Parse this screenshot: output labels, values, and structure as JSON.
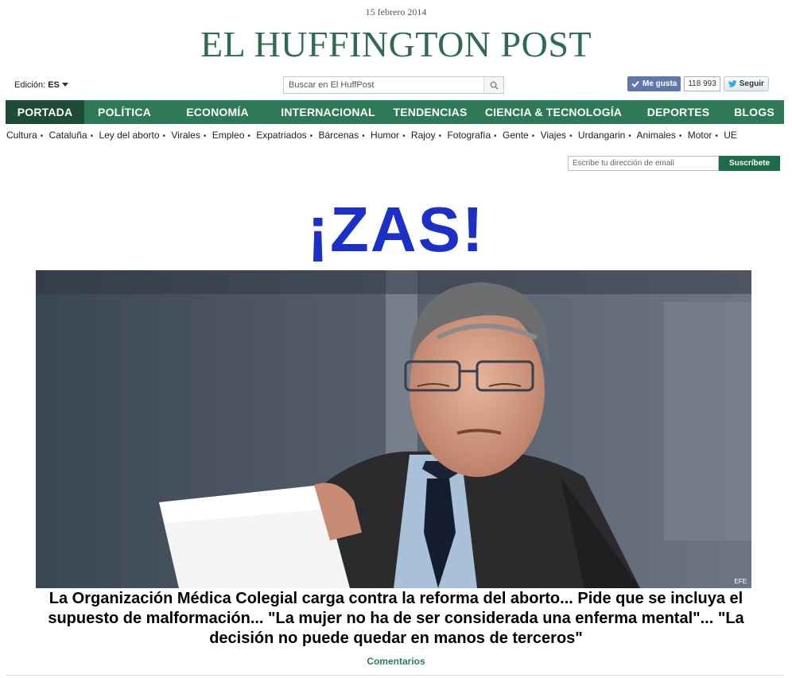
{
  "header": {
    "date": "15 febrero 2014",
    "logo": "EL HUFFINGTON POST",
    "edition_label": "Edición:",
    "edition_value": "ES",
    "search_placeholder": "Buscar en El HuffPost",
    "like_label": "Me gusta",
    "like_count": "118 993",
    "follow_label": "Seguir"
  },
  "nav": [
    {
      "label": "PORTADA"
    },
    {
      "label": "POLÍTICA"
    },
    {
      "label": "ECONOMÍA"
    },
    {
      "label": "INTERNACIONAL"
    },
    {
      "label": "TENDENCIAS"
    },
    {
      "label": "CIENCIA & TECNOLOGÍA"
    },
    {
      "label": "DEPORTES"
    },
    {
      "label": "BLOGS"
    }
  ],
  "subnav": [
    "Cultura",
    "Cataluña",
    "Ley del aborto",
    "Virales",
    "Empleo",
    "Expatriados",
    "Bárcenas",
    "Humor",
    "Rajoy",
    "Fotografía",
    "Gente",
    "Viajes",
    "Urdangarin",
    "Animales",
    "Motor",
    "UE"
  ],
  "newsletter": {
    "placeholder": "Escribe tu dirección de email",
    "button": "Suscríbete"
  },
  "splash": {
    "title": "¡ZAS!",
    "photo_credit": "EFE",
    "headline": "La Organización Médica Colegial carga contra la reforma del aborto... Pide que se incluya el supuesto de malformación... \"La mujer no ha de ser considerada una enferma mental\"... \"La decisión no puede quedar en manos de terceros\"",
    "comments": "Comentarios"
  },
  "colors": {
    "brand_green": "#2e7a57",
    "nav_active": "#1e4c36",
    "splash_blue": "#1d2fc9"
  }
}
